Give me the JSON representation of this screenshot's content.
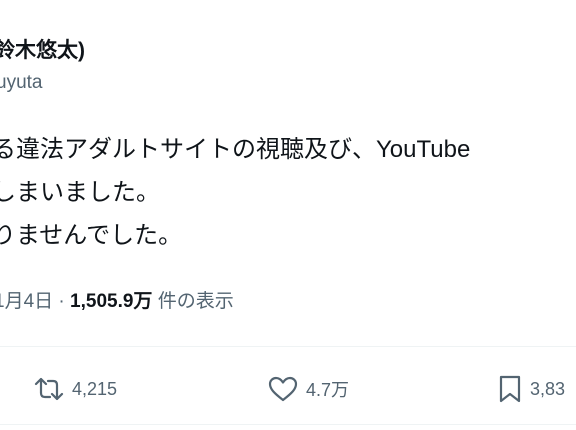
{
  "author": {
    "display_name": "鈴木悠太)",
    "handle": "uyuta"
  },
  "tweet": {
    "lines": [
      "る違法アダルトサイトの視聴及び、YouTube",
      "しまいました。",
      "りませんでした。"
    ]
  },
  "meta": {
    "date": "1月4日",
    "separator": " · ",
    "views_count": "1,505.9万",
    "views_label": " 件の表示"
  },
  "actions": {
    "retweet_count": "4,215",
    "like_count": "4.7万",
    "bookmark_count": "3,83"
  },
  "colors": {
    "text": "#0f1419",
    "secondary": "#536471",
    "divider": "#eff3f4"
  }
}
